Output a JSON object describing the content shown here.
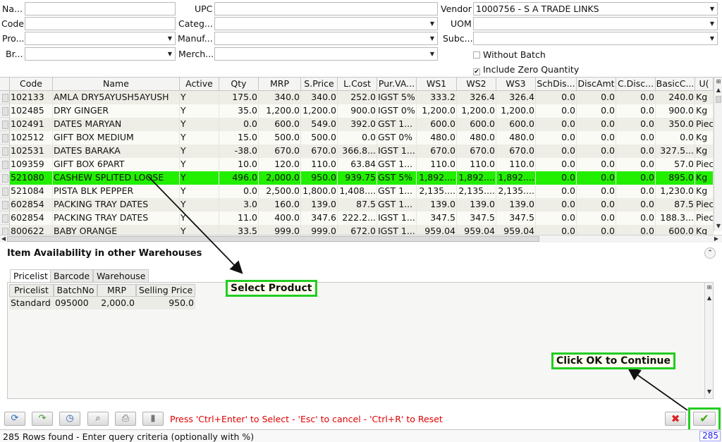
{
  "filters": {
    "name_label": "Na...",
    "code_label": "Code",
    "pro_label": "Pro...",
    "br_label": "Br...",
    "upc_label": "UPC",
    "categ_label": "Categ...",
    "manuf_label": "Manuf...",
    "merch_label": "Merch...",
    "vendor_label": "Vendor",
    "vendor_value": "1000756 - S A TRADE LINKS",
    "uom_label": "UOM",
    "subc_label": "Subc...",
    "without_batch_label": "Without Batch",
    "without_batch_checked": false,
    "include_zero_label": "Include Zero Quantity",
    "include_zero_checked": true
  },
  "grid": {
    "columns": [
      "Code",
      "Name",
      "Active",
      "Qty",
      "MRP",
      "S.Price",
      "L.Cost",
      "Pur.VA...",
      "WS1",
      "WS2",
      "WS3",
      "SchDis...",
      "DiscAmt",
      "C.Disc...",
      "BasicC...",
      "U("
    ],
    "rows": [
      [
        "102133",
        "AMLA DRY5AYUSH5AYUSH",
        "Y",
        "175.0",
        "340.0",
        "340.0",
        "252.0",
        "IGST 5%",
        "333.2",
        "326.4",
        "326.4",
        "0.0",
        "0.0",
        "0.0",
        "240.0",
        "Kg"
      ],
      [
        "102485",
        "DRY GINGER",
        "Y",
        "35.0",
        "1,200.0",
        "1,200.0",
        "900.0",
        "IGST 0%",
        "1,200.0",
        "1,200.0",
        "1,200.0",
        "0.0",
        "0.0",
        "0.0",
        "900.0",
        "Kg"
      ],
      [
        "102491",
        "DATES MARYAN",
        "Y",
        "0.0",
        "600.0",
        "549.0",
        "392.0",
        "GST 1...",
        "600.0",
        "600.0",
        "600.0",
        "0.0",
        "0.0",
        "0.0",
        "350.0",
        "Piec"
      ],
      [
        "102512",
        "GIFT BOX MEDIUM",
        "Y",
        "15.0",
        "500.0",
        "500.0",
        "0.0",
        "GST 0%",
        "480.0",
        "480.0",
        "480.0",
        "0.0",
        "0.0",
        "0.0",
        "0.0",
        "Kg"
      ],
      [
        "102531",
        "DATES BARAKA",
        "Y",
        "-38.0",
        "670.0",
        "670.0",
        "366.8...",
        "IGST 1...",
        "670.0",
        "670.0",
        "670.0",
        "0.0",
        "0.0",
        "0.0",
        "327.5...",
        "Kg"
      ],
      [
        "109359",
        "GIFT BOX 6PART",
        "Y",
        "10.0",
        "120.0",
        "110.0",
        "63.84",
        "GST 1...",
        "110.0",
        "110.0",
        "110.0",
        "0.0",
        "0.0",
        "0.0",
        "57.0",
        "Piec"
      ],
      [
        "521080",
        "CASHEW SPLITED LOOSE",
        "Y",
        "496.0",
        "2,000.0",
        "950.0",
        "939.75",
        "GST 5%",
        "1,892....",
        "1,892....",
        "1,892....",
        "0.0",
        "0.0",
        "0.0",
        "895.0",
        "Kg"
      ],
      [
        "521084",
        "PISTA BLK PEPPER",
        "Y",
        "0.0",
        "2,500.0",
        "1,800.0",
        "1,408....",
        "GST 1...",
        "2,135....",
        "2,135....",
        "2,135....",
        "0.0",
        "0.0",
        "0.0",
        "1,230.0",
        "Kg"
      ],
      [
        "602854",
        "PACKING TRAY DATES",
        "Y",
        "3.0",
        "160.0",
        "139.0",
        "87.5",
        "GST 1...",
        "139.0",
        "139.0",
        "139.0",
        "0.0",
        "0.0",
        "0.0",
        "87.5",
        "Piec"
      ],
      [
        "602854",
        "PACKING TRAY DATES",
        "Y",
        "11.0",
        "400.0",
        "347.6",
        "222.2...",
        "IGST 1...",
        "347.5",
        "347.5",
        "347.5",
        "0.0",
        "0.0",
        "0.0",
        "188.3...",
        "Piec"
      ],
      [
        "800622",
        "BABY ORANGE",
        "Y",
        "33.5",
        "999.0",
        "999.0",
        "672.0",
        "IGST 1...",
        "959.04",
        "959.04",
        "959.04",
        "0.0",
        "0.0",
        "0.0",
        "600.0",
        "Kg"
      ]
    ],
    "selected_row_index": 6
  },
  "availability": {
    "title": "Item Availability in other Warehouses",
    "tabs": [
      "Pricelist",
      "Barcode",
      "Warehouse"
    ],
    "active_tab": "Pricelist",
    "columns": [
      "Pricelist",
      "BatchNo",
      "MRP",
      "Selling Price"
    ],
    "rows": [
      [
        "Standard",
        "095000",
        "2,000.0",
        "950.0"
      ]
    ]
  },
  "callouts": {
    "select_product": "Select Product",
    "click_ok": "Click OK to Continue"
  },
  "toolbar": {
    "hint": "Press 'Ctrl+Enter' to Select - 'Esc' to cancel - 'Ctrl+R' to Reset",
    "buttons": [
      "refresh-icon",
      "redo-icon",
      "history-icon",
      "zoom-icon",
      "print-icon",
      "delete-icon"
    ]
  },
  "status": {
    "text": "285 Rows found - Enter query criteria (optionally with %)",
    "count": "285"
  },
  "colors": {
    "selected_row": "#22ee00",
    "callout_border": "#22cc22",
    "hint_text": "#e00000",
    "cancel_icon": "#dd2222",
    "ok_icon": "#44aa11"
  }
}
